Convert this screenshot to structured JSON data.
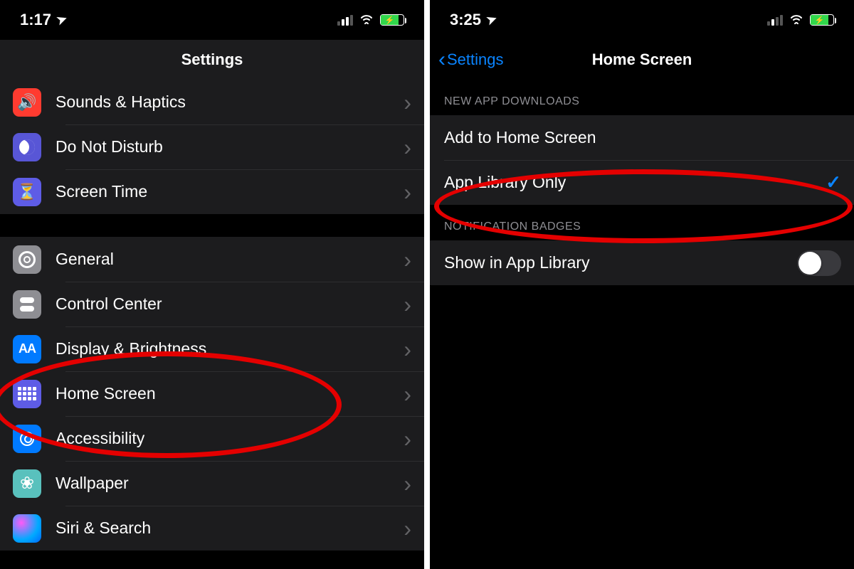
{
  "left": {
    "status": {
      "time": "1:17",
      "location_glyph": "➤"
    },
    "title": "Settings",
    "group1": [
      {
        "key": "sounds",
        "label": "Sounds & Haptics",
        "icon": "speaker-icon",
        "bg": "bg-red",
        "glyph": "🔊"
      },
      {
        "key": "dnd",
        "label": "Do Not Disturb",
        "icon": "moon-icon",
        "bg": "bg-purple",
        "glyph": ""
      },
      {
        "key": "screentime",
        "label": "Screen Time",
        "icon": "hourglass-icon",
        "bg": "bg-indigo",
        "glyph": "⌛"
      }
    ],
    "group2": [
      {
        "key": "general",
        "label": "General",
        "icon": "gear-icon",
        "bg": "bg-gray",
        "glyph": ""
      },
      {
        "key": "control",
        "label": "Control Center",
        "icon": "toggles-icon",
        "bg": "bg-gray",
        "glyph": ""
      },
      {
        "key": "display",
        "label": "Display & Brightness",
        "icon": "text-size-icon",
        "bg": "bg-blue",
        "glyph": "AA"
      },
      {
        "key": "home",
        "label": "Home Screen",
        "icon": "app-grid-icon",
        "bg": "bg-indigo",
        "glyph": ""
      },
      {
        "key": "access",
        "label": "Accessibility",
        "icon": "accessibility-icon",
        "bg": "bg-blue",
        "glyph": ""
      },
      {
        "key": "wallpaper",
        "label": "Wallpaper",
        "icon": "flower-icon",
        "bg": "bg-teal",
        "glyph": "❀"
      },
      {
        "key": "siri",
        "label": "Siri & Search",
        "icon": "siri-icon",
        "bg": "",
        "glyph": ""
      }
    ]
  },
  "right": {
    "status": {
      "time": "3:25",
      "location_glyph": "➤"
    },
    "back_label": "Settings",
    "title": "Home Screen",
    "section1_header": "NEW APP DOWNLOADS",
    "option_home": "Add to Home Screen",
    "option_library": "App Library Only",
    "section2_header": "NOTIFICATION BADGES",
    "toggle_label": "Show in App Library",
    "toggle_on": false
  }
}
